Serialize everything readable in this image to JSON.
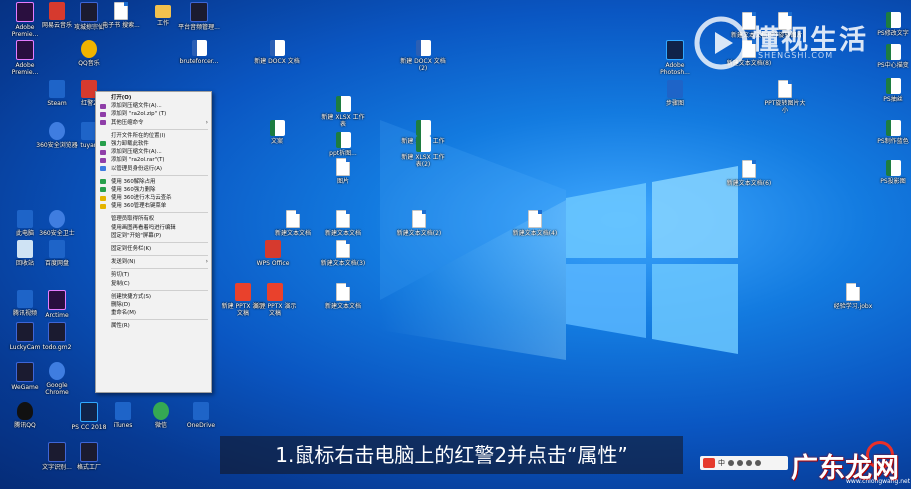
{
  "desktop": {
    "icons": [
      {
        "label": "Adobe Premie...",
        "kind": "app-pr"
      },
      {
        "label": "网易云音乐",
        "kind": "app-red"
      },
      {
        "label": "攻城掠宗仙",
        "kind": "app-dark"
      },
      {
        "label": "电子书\n搜索...",
        "kind": "file"
      },
      {
        "label": "工作",
        "kind": "folder"
      },
      {
        "label": "平台音频管理...",
        "kind": "app-dark"
      },
      {
        "label": "Adobe Premie...",
        "kind": "app-pr"
      },
      {
        "label": "QQ音乐",
        "kind": "app-yellow"
      },
      {
        "label": "Steam",
        "kind": "app-blue"
      },
      {
        "label": "红警2",
        "kind": "app-red"
      },
      {
        "label": "360安全浏览器",
        "kind": "logo-c"
      },
      {
        "label": "tuyan",
        "kind": "app-blue"
      },
      {
        "label": "此电脑",
        "kind": "app-blue"
      },
      {
        "label": "360安全卫士",
        "kind": "logo-c"
      },
      {
        "label": "回收站",
        "kind": "recycle"
      },
      {
        "label": "百度网盘",
        "kind": "app-blue"
      },
      {
        "label": "腾讯视频",
        "kind": "app-blue"
      },
      {
        "label": "Arctime",
        "kind": "app-pr"
      },
      {
        "label": "LuckyCam",
        "kind": "app-dark"
      },
      {
        "label": "todo.gm2",
        "kind": "app-dark"
      },
      {
        "label": "WeGame",
        "kind": "app-dark"
      },
      {
        "label": "Google Chrome",
        "kind": "logo-c"
      },
      {
        "label": "腾讯QQ",
        "kind": "penguin"
      },
      {
        "label": "PS CC 2018",
        "kind": "app-ps"
      },
      {
        "label": "iTunes",
        "kind": "app-blue"
      },
      {
        "label": "微信",
        "kind": "app-green"
      },
      {
        "label": "OneDrive",
        "kind": "app-blue"
      },
      {
        "label": "文字识别...",
        "kind": "app-dark"
      },
      {
        "label": "格式工厂",
        "kind": "app-dark"
      },
      {
        "label": "WPS Office",
        "kind": "app-red"
      },
      {
        "label": "bruteforcer...",
        "kind": "word"
      },
      {
        "label": "新建 DOCX 文档",
        "kind": "word"
      },
      {
        "label": "新建 DOCX 文档(2)",
        "kind": "word"
      },
      {
        "label": "新建 XLSX 工作表",
        "kind": "excel"
      },
      {
        "label": "新建 XLSX 工作表",
        "kind": "excel"
      },
      {
        "label": "文案",
        "kind": "excel"
      },
      {
        "label": "ppt拆图...",
        "kind": "excel"
      },
      {
        "label": "新建 XLSX 工作表(2)",
        "kind": "excel"
      },
      {
        "label": "图片",
        "kind": "file"
      },
      {
        "label": "新建文本文档",
        "kind": "file"
      },
      {
        "label": "新建文本文档(2)",
        "kind": "file"
      },
      {
        "label": "新建文本文档(4)",
        "kind": "file"
      },
      {
        "label": "新建文本文档(3)",
        "kind": "file"
      },
      {
        "label": "新建文本文档(6)",
        "kind": "file"
      },
      {
        "label": "新建文本文档",
        "kind": "file"
      },
      {
        "label": "新建 PPTX 演示文稿",
        "kind": "pdf"
      },
      {
        "label": "新建 PPTX 演示文稿",
        "kind": "pdf"
      },
      {
        "label": "新建文本文档",
        "kind": "file"
      },
      {
        "label": "经验学习.jobx",
        "kind": "file"
      },
      {
        "label": "Adobe Photosh...",
        "kind": "app-ps"
      },
      {
        "label": "新建文本文档",
        "kind": "file"
      },
      {
        "label": "PPT旋转图片",
        "kind": "file"
      },
      {
        "label": "PS修改文字",
        "kind": "excel"
      },
      {
        "label": "PS中心描变",
        "kind": "excel"
      },
      {
        "label": "PS抽丝",
        "kind": "excel"
      },
      {
        "label": "PS制作蓝色",
        "kind": "excel"
      },
      {
        "label": "PS投影图",
        "kind": "excel"
      },
      {
        "label": "步骤图",
        "kind": "app-blue"
      },
      {
        "label": "PPT旋转图片大小",
        "kind": "file"
      },
      {
        "label": "新建文本文档(8)",
        "kind": "file"
      }
    ]
  },
  "context_menu": {
    "items": [
      {
        "label": "打开(O)",
        "bold": true,
        "icon": ""
      },
      {
        "label": "添加到压缩文件(A)...",
        "icon": "rar"
      },
      {
        "label": "添加到 \"ra2ol.zip\" (T)",
        "icon": "rar"
      },
      {
        "label": "其他压缩命令",
        "icon": "rar",
        "submenu": true
      },
      {
        "sep": true
      },
      {
        "label": "打开文件所在的位置(I)",
        "icon": ""
      },
      {
        "label": "强力卸载此软件",
        "icon": "z360"
      },
      {
        "label": "添加到压缩文件(A)...",
        "icon": "rar"
      },
      {
        "label": "添加到 \"ra2ol.rar\"(T)",
        "icon": "rar"
      },
      {
        "label": "以管理员身份运行(A)",
        "icon": "shield"
      },
      {
        "sep": true
      },
      {
        "label": "使用 360解除占用",
        "icon": "z360"
      },
      {
        "label": "使用 360强力删除",
        "icon": "z360"
      },
      {
        "label": "使用 360进行木马云查杀",
        "icon": "y"
      },
      {
        "label": "使用 360管理右键菜单",
        "icon": "y"
      },
      {
        "sep": true
      },
      {
        "label": "管理员取得所有权",
        "icon": ""
      },
      {
        "label": "使用画图再看着吗进行编辑",
        "icon": ""
      },
      {
        "label": "固定到\"开始\"屏幕(P)",
        "icon": ""
      },
      {
        "sep": true
      },
      {
        "label": "固定到任务栏(K)",
        "icon": ""
      },
      {
        "sep": true
      },
      {
        "label": "发送到(N)",
        "icon": "",
        "submenu": true
      },
      {
        "sep": true
      },
      {
        "label": "剪切(T)",
        "icon": ""
      },
      {
        "label": "复制(C)",
        "icon": ""
      },
      {
        "sep": true
      },
      {
        "label": "创建快捷方式(S)",
        "icon": ""
      },
      {
        "label": "删除(D)",
        "icon": ""
      },
      {
        "label": "重命名(M)",
        "icon": ""
      },
      {
        "sep": true
      },
      {
        "label": "属性(R)",
        "icon": ""
      }
    ]
  },
  "caption": {
    "text": "1.鼠标右击电脑上的红警2并点击“属性”"
  },
  "watermark": {
    "brand": "懂视生活",
    "domain": "SHENGSHI.COM"
  },
  "watermark2": {
    "brand": "广东龙网",
    "domain": "www.cnlongwang.net"
  },
  "tray": {
    "ime": "中"
  },
  "colors": {
    "accent": "#0a56c2",
    "caption_bg": "#1a1a26"
  }
}
